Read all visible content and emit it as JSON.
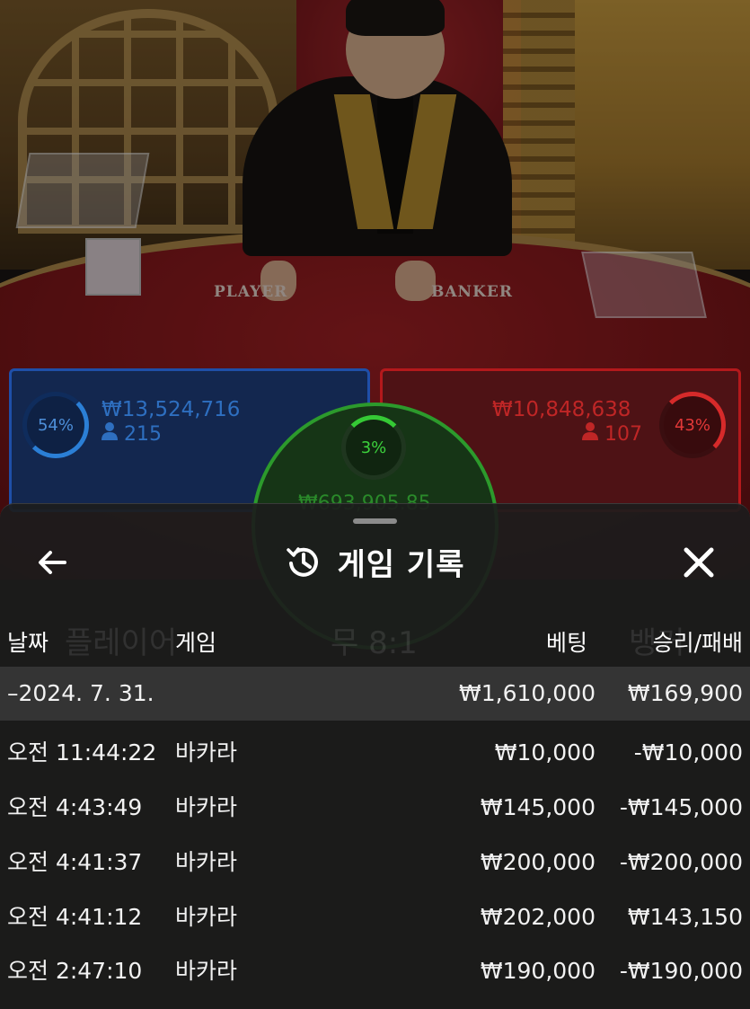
{
  "table": {
    "player_label": "PLAYER",
    "banker_label": "BANKER"
  },
  "bets": {
    "player": {
      "percent": "54%",
      "amount": "₩13,524,716",
      "users": "215",
      "fill": 0.54
    },
    "banker": {
      "percent": "43%",
      "amount": "₩10,848,638",
      "users": "107",
      "fill": 0.43
    },
    "tie": {
      "percent": "3%",
      "amount": "₩693,905.85",
      "fill": 0.03
    }
  },
  "ghost_labels": {
    "player_pair": "플레이어",
    "tie_ratio": "무 8:1",
    "banker": "뱅커"
  },
  "sheet": {
    "title": "게임 기록",
    "icons": {
      "back": "arrow-left-icon",
      "history": "history-icon",
      "close": "close-icon"
    },
    "columns": {
      "date": "날짜",
      "game": "게임",
      "bet": "베팅",
      "result": "승리/패배"
    },
    "rows": [
      {
        "date": "–2024. 7. 31.",
        "game": "",
        "bet": "₩1,610,000",
        "result": "₩169,900"
      },
      {
        "date": "오전 11:44:22",
        "game": "바카라",
        "bet": "₩10,000",
        "result": "-₩10,000"
      },
      {
        "date": "오전 4:43:49",
        "game": "바카라",
        "bet": "₩145,000",
        "result": "-₩145,000"
      },
      {
        "date": "오전 4:41:37",
        "game": "바카라",
        "bet": "₩200,000",
        "result": "-₩200,000"
      },
      {
        "date": "오전 4:41:12",
        "game": "바카라",
        "bet": "₩202,000",
        "result": "₩143,150"
      },
      {
        "date": "오전 2:47:10",
        "game": "바카라",
        "bet": "₩190,000",
        "result": "-₩190,000"
      }
    ]
  },
  "colors": {
    "player": "#2e6fc0",
    "banker": "#bf2626",
    "tie": "#3cd13c",
    "sheet_bg": "#1c1c1c"
  }
}
